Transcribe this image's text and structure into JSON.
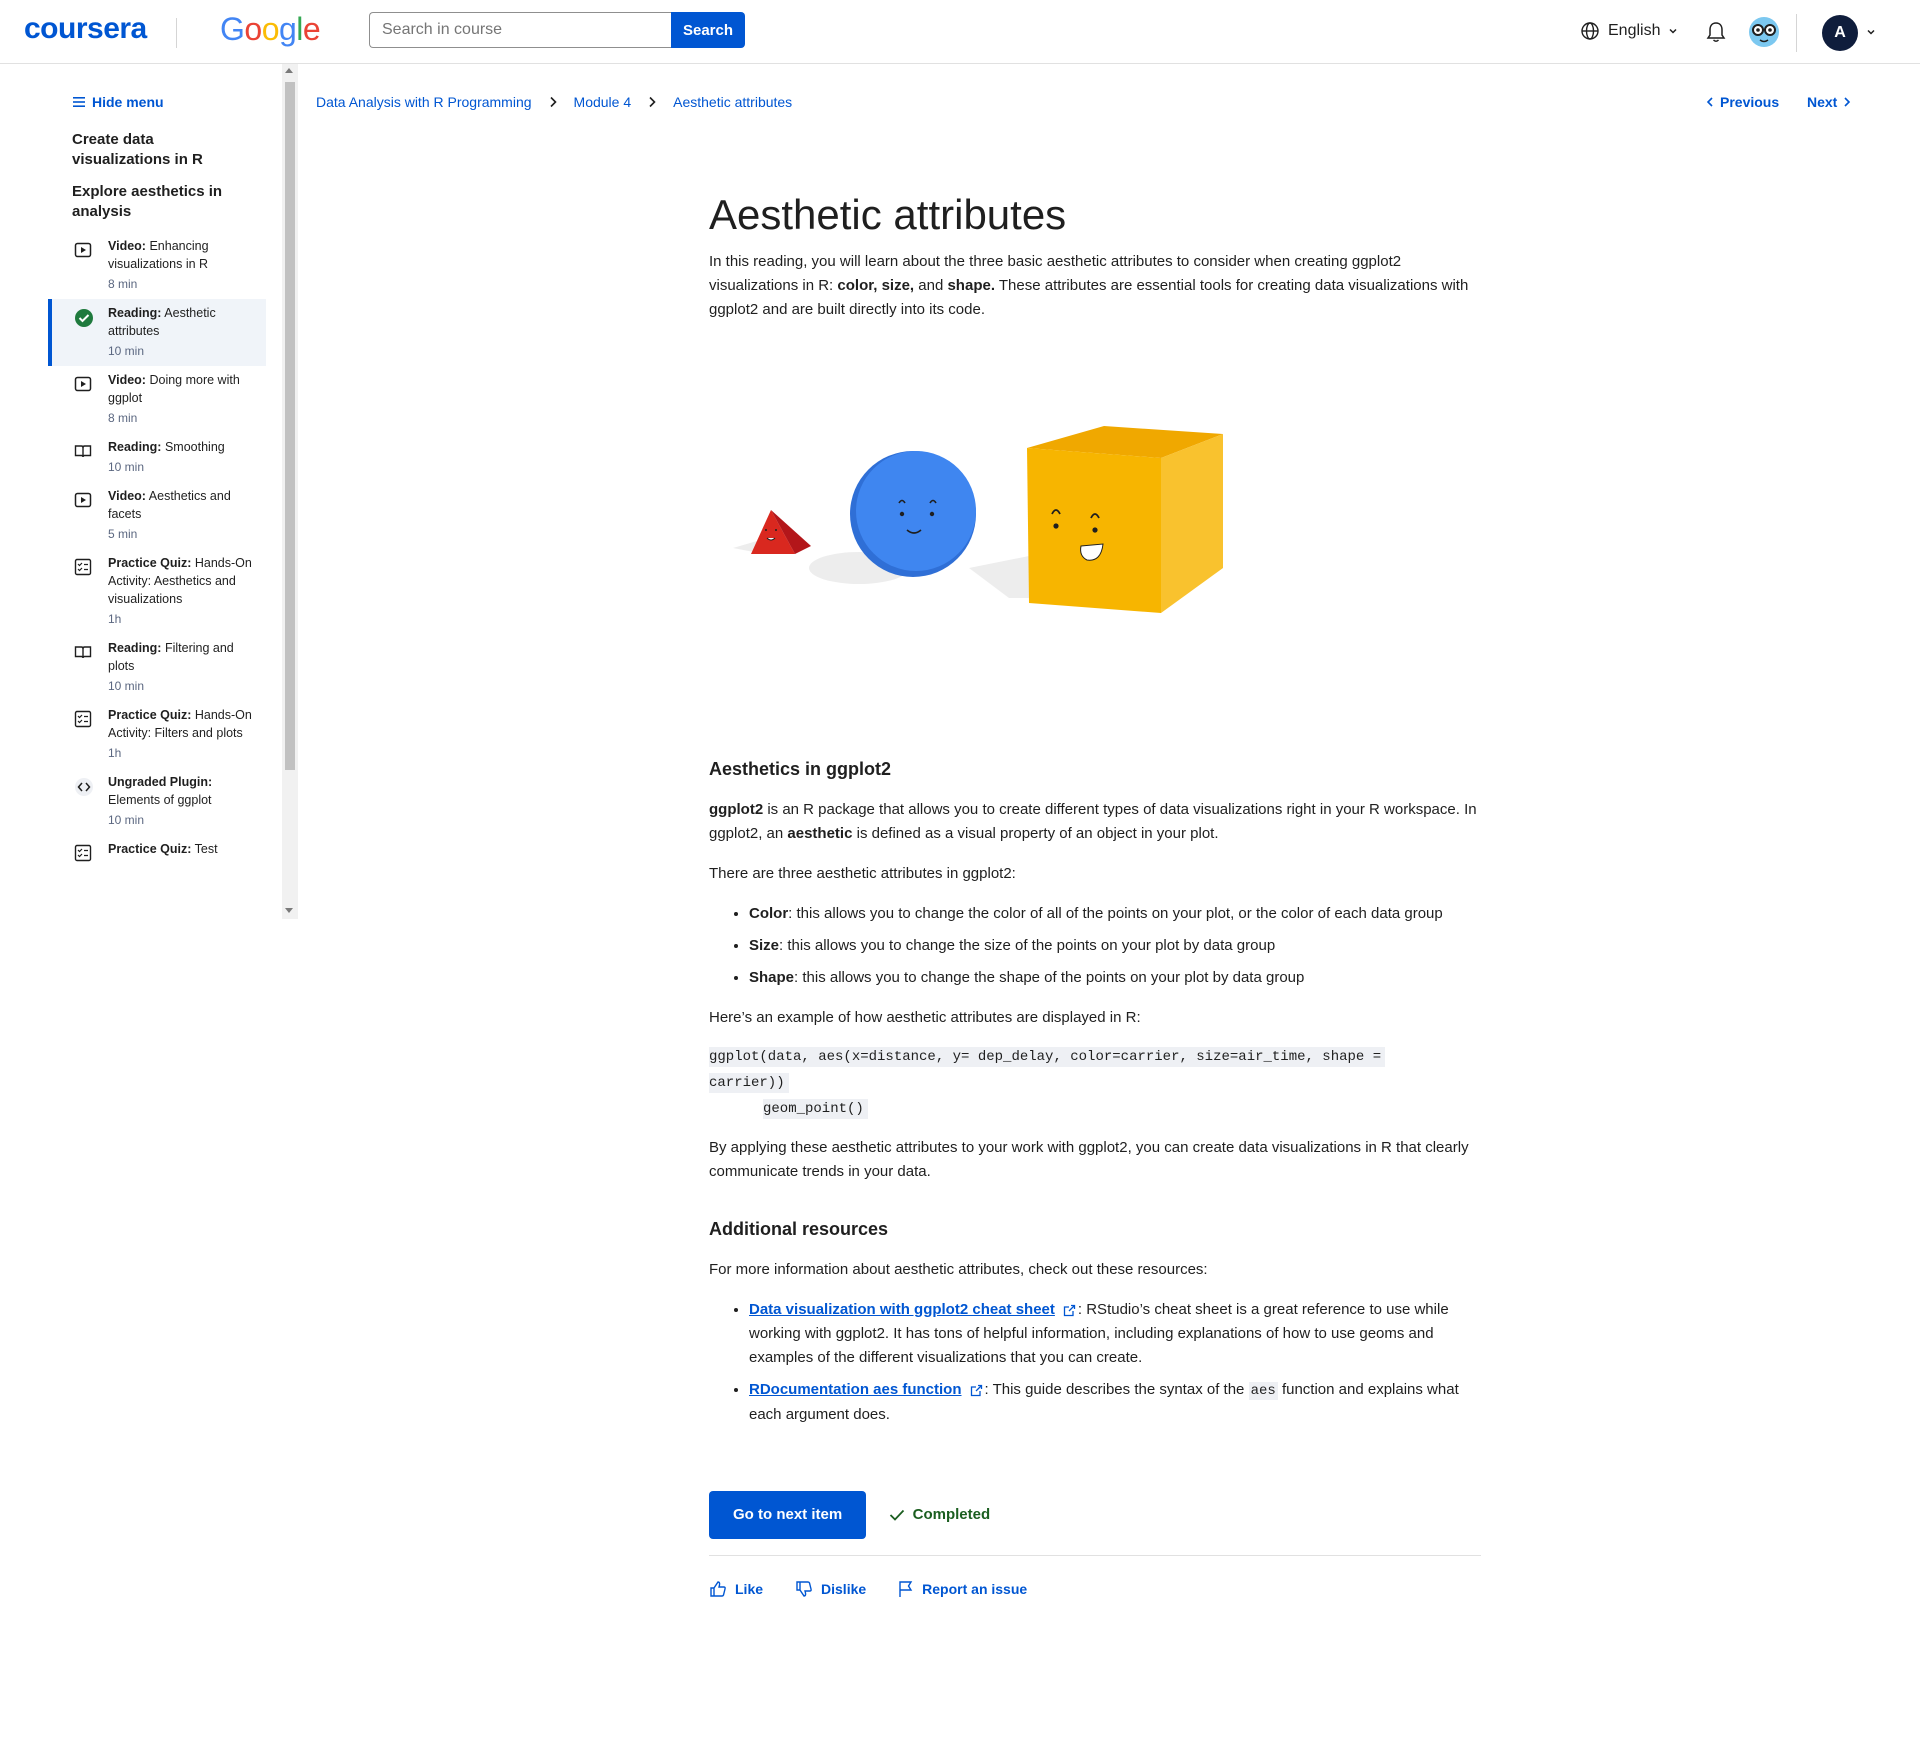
{
  "header": {
    "brand": "coursera",
    "partner": "Google",
    "search_placeholder": "Search in course",
    "search_button": "Search",
    "language": "English",
    "avatar_initial": "A"
  },
  "sidebar": {
    "hide_menu": "Hide menu",
    "module_title": "Create data visualizations in R",
    "lesson_title": "Explore aesthetics in analysis",
    "items": [
      {
        "type": "Video:",
        "title": "Enhancing visualizations in R",
        "duration": "8 min",
        "icon": "play-icon",
        "active": false
      },
      {
        "type": "Reading:",
        "title": "Aesthetic attributes",
        "duration": "10 min",
        "icon": "check-circle-icon",
        "active": true
      },
      {
        "type": "Video:",
        "title": "Doing more with ggplot",
        "duration": "8 min",
        "icon": "play-icon",
        "active": false
      },
      {
        "type": "Reading:",
        "title": "Smoothing",
        "duration": "10 min",
        "icon": "book-icon",
        "active": false
      },
      {
        "type": "Video:",
        "title": "Aesthetics and facets",
        "duration": "5 min",
        "icon": "play-icon",
        "active": false
      },
      {
        "type": "Practice Quiz:",
        "title": "Hands-On Activity: Aesthetics and visualizations",
        "duration": "1h",
        "icon": "quiz-icon",
        "active": false
      },
      {
        "type": "Reading:",
        "title": "Filtering and plots",
        "duration": "10 min",
        "icon": "book-icon",
        "active": false
      },
      {
        "type": "Practice Quiz:",
        "title": "Hands-On Activity: Filters and plots",
        "duration": "1h",
        "icon": "quiz-icon",
        "active": false
      },
      {
        "type": "Ungraded Plugin:",
        "title": "Elements of ggplot",
        "duration": "10 min",
        "icon": "code-icon",
        "active": false
      },
      {
        "type": "Practice Quiz:",
        "title": "Test",
        "duration": "",
        "icon": "quiz-icon",
        "active": false
      }
    ]
  },
  "breadcrumb": {
    "course": "Data Analysis with R Programming",
    "module": "Module 4",
    "item": "Aesthetic attributes"
  },
  "nav": {
    "previous": "Previous",
    "next": "Next"
  },
  "main": {
    "title": "Aesthetic attributes",
    "intro_1": "In this reading, you will learn about the three basic aesthetic attributes to consider when creating ggplot2 visualizations in R: ",
    "intro_bold_1": "color, size,",
    "intro_2": " and ",
    "intro_bold_2": "shape.",
    "intro_3": " These attributes are essential tools for creating data visualizations with ggplot2 and are built directly into its code.",
    "section1_heading": "Aesthetics in ggplot2",
    "p1_bold_1": "ggplot2",
    "p1_a": " is an R package that allows you to create different types of data visualizations right in your R workspace. In ggplot2, an ",
    "p1_bold_2": "aesthetic",
    "p1_b": " is defined as a visual property of an object in your plot.",
    "p2": "There are three aesthetic attributes in ggplot2:",
    "bullets": [
      {
        "term": "Color",
        "text": ": this allows you to change the color of all of the points on your plot, or the color of each data group"
      },
      {
        "term": "Size",
        "text": ": this allows you to change the size of the points on your plot by data group"
      },
      {
        "term": "Shape",
        "text": ": this allows you to change the shape of the points on your plot by data group"
      }
    ],
    "p3": "Here’s an example of how aesthetic attributes are displayed in R:",
    "code_line1": "ggplot(data, aes(x=distance, y= dep_delay, color=carrier, size=air_time, shape =",
    "code_line2": "carrier))",
    "code_line3": "geom_point()",
    "p4": "By applying these aesthetic attributes to your work with ggplot2, you can create data visualizations in R that clearly communicate trends in your data.",
    "section2_heading": "Additional resources",
    "p5": "For more information about aesthetic attributes, check out these resources:",
    "res1_link": "Data visualization with ggplot2 cheat sheet",
    "res1_text": ": RStudio’s cheat sheet is a great reference to use while working with ggplot2. It has tons of helpful information, including explanations of how to use geoms and examples of the different visualizations that you can create.",
    "res2_link": "RDocumentation aes function",
    "res2_text_a": ": This guide describes the syntax of the ",
    "res2_code": "aes",
    "res2_text_b": " function and explains what each argument does.",
    "next_button": "Go to next item",
    "completed": "Completed",
    "like": "Like",
    "dislike": "Dislike",
    "report": "Report an issue"
  },
  "colors": {
    "primary": "#0056d2",
    "completed": "#1b5e20",
    "triangle": "#e0312b",
    "circle": "#3f7fe8",
    "cube": "#f7b500"
  }
}
